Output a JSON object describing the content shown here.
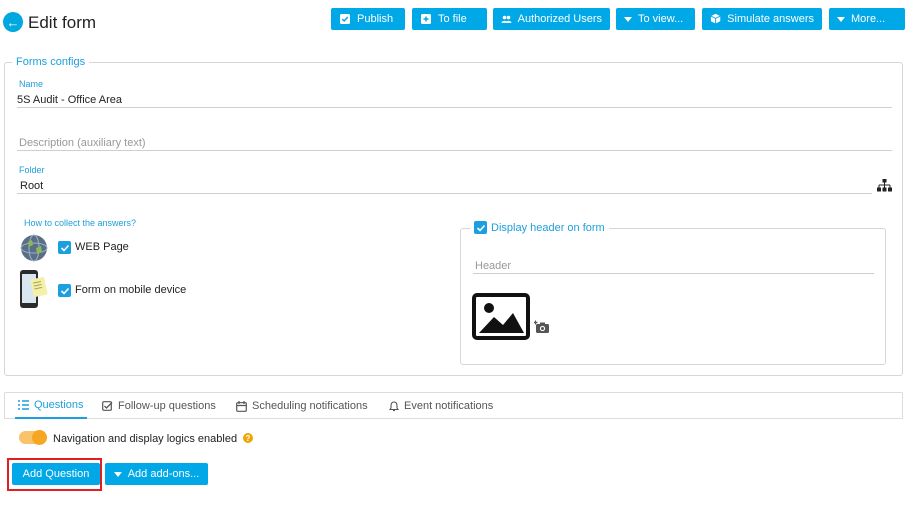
{
  "header": {
    "title": "Edit form"
  },
  "toolbar": {
    "publish": "Publish",
    "to_file": "To file",
    "authorized_users": "Authorized Users",
    "to_view": "To view...",
    "simulate": "Simulate answers",
    "more": "More..."
  },
  "forms_config": {
    "legend": "Forms configs",
    "name_label": "Name",
    "name_value": "5S Audit - Office Area",
    "description_placeholder": "Description (auxiliary text)",
    "folder_label": "Folder",
    "folder_value": "Root"
  },
  "collect": {
    "label": "How to collect the answers?",
    "web_page": "WEB Page",
    "mobile": "Form on mobile device"
  },
  "display_header": {
    "label": "Display header on form",
    "header_placeholder": "Header"
  },
  "tabs": [
    {
      "label": "Questions",
      "icon": "list-icon"
    },
    {
      "label": "Follow-up questions",
      "icon": "checkbox-icon"
    },
    {
      "label": "Scheduling notifications",
      "icon": "calendar-icon"
    },
    {
      "label": "Event notifications",
      "icon": "bell-icon"
    }
  ],
  "logic": {
    "label": "Navigation and display logics enabled",
    "enabled": true
  },
  "actions": {
    "add_question": "Add Question",
    "add_addons": "Add add-ons..."
  },
  "colors": {
    "accent": "#00a8e8",
    "toggle": "#f5a623",
    "highlight": "#e02020"
  }
}
